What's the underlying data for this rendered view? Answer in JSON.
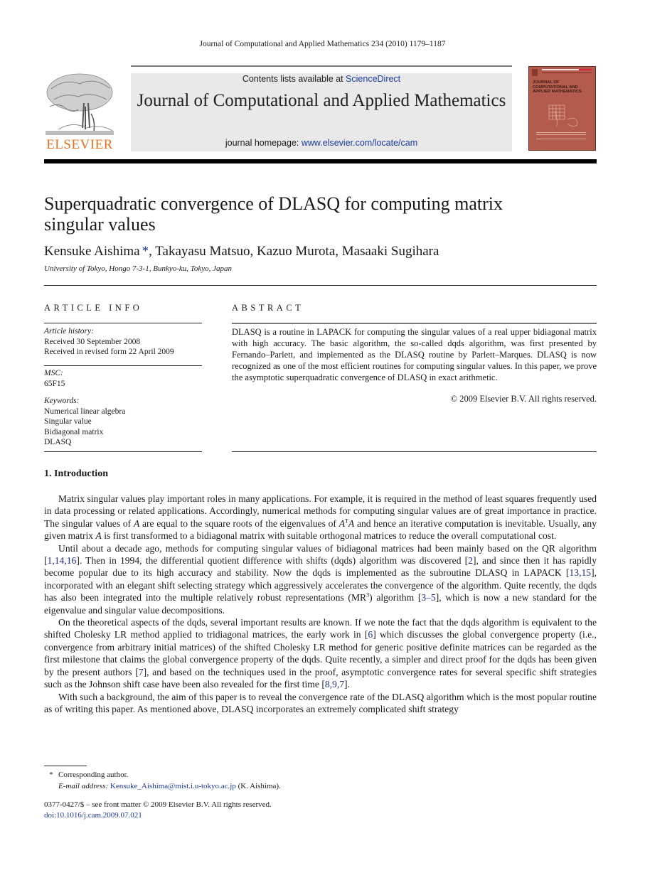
{
  "running_head": "Journal of Computational and Applied Mathematics 234 (2010) 1179–1187",
  "masthead": {
    "contents_prefix": "Contents lists available at ",
    "contents_link": "ScienceDirect",
    "journal_title": "Journal of Computational and Applied Mathematics",
    "homepage_prefix": "journal homepage: ",
    "homepage_link": "www.elsevier.com/locate/cam",
    "publisher_logo_text": "ELSEVIER",
    "cover_title": "JOURNAL OF COMPUTATIONAL AND APPLIED MATHEMATICS",
    "colors": {
      "publisher_orange": "#e9711c",
      "link_blue": "#1a3aa0",
      "cover_red": "#b35c4d",
      "masthead_gray": "#e9e9e9"
    }
  },
  "article": {
    "title": "Superquadratic convergence of DLASQ for computing matrix singular values",
    "authors": [
      {
        "name": "Kensuke Aishima",
        "mark": "*"
      },
      {
        "name": "Takayasu Matsuo"
      },
      {
        "name": "Kazuo Murota"
      },
      {
        "name": "Masaaki Sugihara"
      }
    ],
    "affiliation": "University of Tokyo, Hongo 7-3-1, Bunkyo-ku, Tokyo, Japan"
  },
  "article_info": {
    "heading": "ARTICLE INFO",
    "history_label": "Article history:",
    "received": "Received 30 September 2008",
    "revised": "Received in revised form 22 April 2009",
    "msc_label": "MSC:",
    "msc": "65F15",
    "keywords_label": "Keywords:",
    "keywords": [
      "Numerical linear algebra",
      "Singular value",
      "Bidiagonal matrix",
      "DLASQ"
    ]
  },
  "abstract": {
    "heading": "ABSTRACT",
    "text": "DLASQ is a routine in LAPACK for computing the singular values of a real upper bidiagonal matrix with high accuracy. The basic algorithm, the so-called dqds algorithm, was first presented by Fernando–Parlett, and implemented as the DLASQ routine by Parlett–Marques. DLASQ is now recognized as one of the most efficient routines for computing singular values. In this paper, we prove the asymptotic superquadratic convergence of DLASQ in exact arithmetic.",
    "copyright": "© 2009 Elsevier B.V. All rights reserved."
  },
  "introduction": {
    "heading": "1.  Introduction",
    "p1": {
      "a": "Matrix singular values play important roles in many applications. For example, it is required in the method of least squares frequently used in data processing or related applications. Accordingly, numerical methods for computing singular values are of great importance in practice. The singular values of ",
      "A1": "A",
      "b": " are equal to the square roots of the eigenvalues of ",
      "AT": "A",
      "T": "T",
      "A2": "A",
      "c": " and hence an iterative computation is inevitable. Usually, any given matrix ",
      "A3": "A",
      "d": " is first transformed to a bidiagonal matrix with suitable orthogonal matrices to reduce the overall computational cost."
    },
    "p2": {
      "a": "Until about a decade ago, methods for computing singular values of bidiagonal matrices had been mainly based on the QR algorithm [",
      "c1": "1,14,16",
      "b": "]. Then in 1994, the differential quotient difference with shifts (dqds) algorithm was discovered [",
      "c2": "2",
      "c": "], and since then it has rapidly become popular due to its high accuracy and stability. Now the dqds is implemented as the subroutine DLASQ in LAPACK [",
      "c3": "13,15",
      "d": "], incorporated with an elegant shift selecting strategy which aggressively accelerates the convergence of the algorithm. Quite recently, the dqds has also been integrated into the multiple relatively robust representations (MR",
      "sup": "3",
      "e": ") algorithm [",
      "c4": "3–5",
      "f": "], which is now a new standard for the eigenvalue and singular value decompositions."
    },
    "p3": {
      "a": "On the theoretical aspects of the dqds, several important results are known. If we note the fact that the dqds algorithm is equivalent to the shifted Cholesky LR method applied to tridiagonal matrices, the early work in [",
      "c1": "6",
      "b": "] which discusses the global convergence property (i.e., convergence from arbitrary initial matrices) of the shifted Cholesky LR method for generic positive definite matrices can be regarded as the first milestone that claims the global convergence property of the dqds. Quite recently, a simpler and direct proof for the dqds has been given by the present authors [",
      "c2": "7",
      "c": "], and based on the techniques used in the proof, asymptotic convergence rates for several specific shift strategies such as the Johnson shift case have been also revealed for the first time [",
      "c3": "8,9,7",
      "d": "]."
    },
    "p4": "With such a background, the aim of this paper is to reveal the convergence rate of the DLASQ algorithm which is the most popular routine as of writing this paper. As mentioned above, DLASQ incorporates an extremely complicated shift strategy"
  },
  "footnote": {
    "mark": "*",
    "corresponding": "Corresponding author.",
    "email_label": "E-mail address:",
    "email": "Kensuke_Aishima@mist.i.u-tokyo.ac.jp",
    "email_suffix": " (K. Aishima)."
  },
  "front_matter": {
    "issn_line": "0377-0427/$ – see front matter © 2009 Elsevier B.V. All rights reserved.",
    "doi": "doi:10.1016/j.cam.2009.07.021"
  }
}
